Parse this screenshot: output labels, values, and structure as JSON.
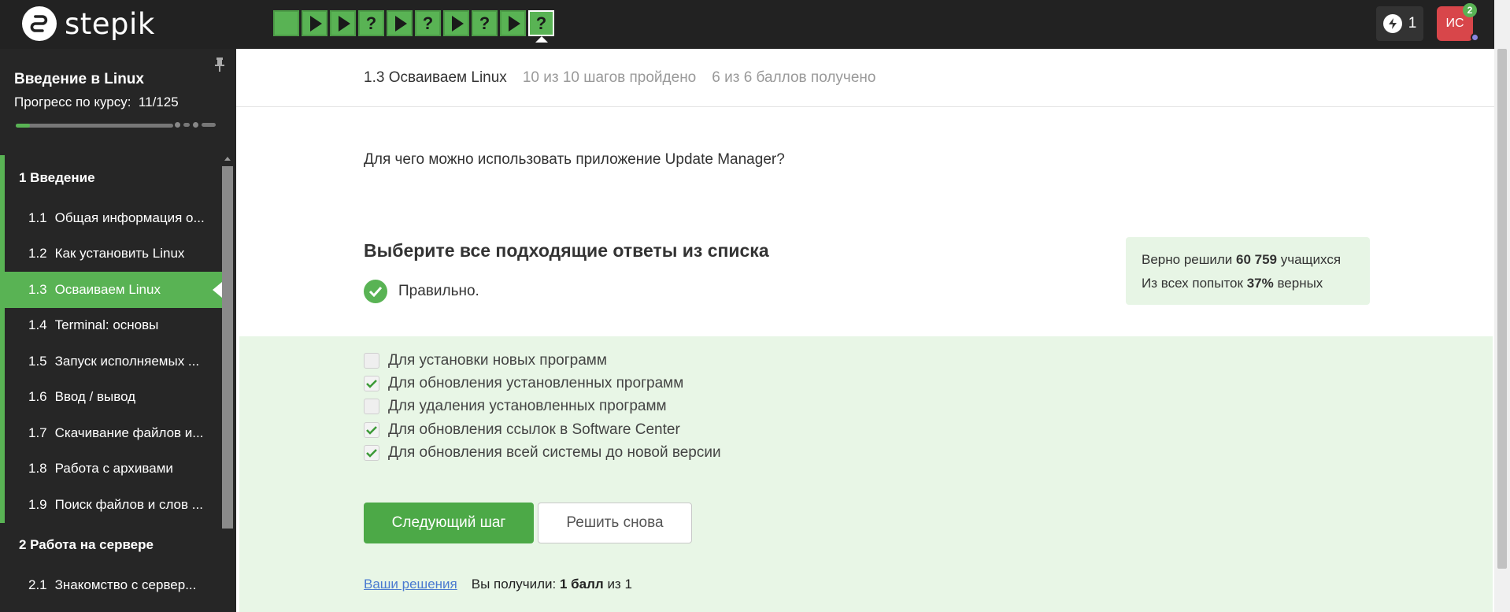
{
  "header": {
    "logo_text": "stepik",
    "steps": [
      {
        "type": "done"
      },
      {
        "type": "video"
      },
      {
        "type": "video"
      },
      {
        "type": "quiz",
        "label": "?"
      },
      {
        "type": "video"
      },
      {
        "type": "quiz",
        "label": "?"
      },
      {
        "type": "video"
      },
      {
        "type": "quiz",
        "label": "?"
      },
      {
        "type": "video"
      },
      {
        "type": "quiz",
        "label": "?",
        "active": true
      }
    ],
    "energy_count": "1",
    "avatar_initials": "ИС",
    "notifications_count": "2"
  },
  "sidebar": {
    "course_title": "Введение в Linux",
    "progress_label": "Прогресс по курсу:",
    "progress_value": "11/125",
    "progress_fraction": 0.088,
    "modules": [
      {
        "label": "1  Введение",
        "lessons": [
          {
            "num": "1.1",
            "label": "Общая информация о..."
          },
          {
            "num": "1.2",
            "label": "Как установить Linux"
          },
          {
            "num": "1.3",
            "label": "Осваиваем Linux",
            "active": true
          },
          {
            "num": "1.4",
            "label": "Terminal: основы"
          },
          {
            "num": "1.5",
            "label": "Запуск исполняемых ..."
          },
          {
            "num": "1.6",
            "label": "Ввод / вывод"
          },
          {
            "num": "1.7",
            "label": "Скачивание файлов и..."
          },
          {
            "num": "1.8",
            "label": "Работа с архивами"
          },
          {
            "num": "1.9",
            "label": "Поиск файлов и слов ..."
          }
        ]
      },
      {
        "label": "2  Работа на сервере",
        "lessons": [
          {
            "num": "2.1",
            "label": "Знакомство с сервер..."
          }
        ]
      }
    ]
  },
  "main": {
    "lesson_name": "1.3 Осваиваем Linux",
    "steps_passed": "10 из 10 шагов пройдено",
    "points": "6 из 6 баллов  получено",
    "question": "Для чего можно использовать приложение Update Manager?",
    "instruction": "Выберите все подходящие ответы из списка",
    "correct_text": "Правильно.",
    "stats": {
      "line1_prefix": "Верно решили",
      "line1_value": "60 759",
      "line1_suffix": "учащихся",
      "line2_prefix": "Из всех попыток",
      "line2_value": "37%",
      "line2_suffix": "верных"
    },
    "options": [
      {
        "label": "Для установки новых программ",
        "checked": false
      },
      {
        "label": "Для обновления установленных программ",
        "checked": true
      },
      {
        "label": "Для удаления установленных программ",
        "checked": false
      },
      {
        "label": "Для обновления ссылок в Software Center",
        "checked": true
      },
      {
        "label": "Для обновления всей системы до новой версии",
        "checked": true
      }
    ],
    "next_button": "Следующий шаг",
    "retry_button": "Решить снова",
    "solutions_link": "Ваши решения",
    "result_prefix": "Вы получили:",
    "result_value": "1 балл",
    "result_of": "из",
    "result_total": "1"
  },
  "colors": {
    "accent": "#59b354",
    "topbar": "#222222",
    "sidebar": "#262626",
    "answers_bg": "#e8f6e6",
    "avatar": "#d8464a"
  }
}
